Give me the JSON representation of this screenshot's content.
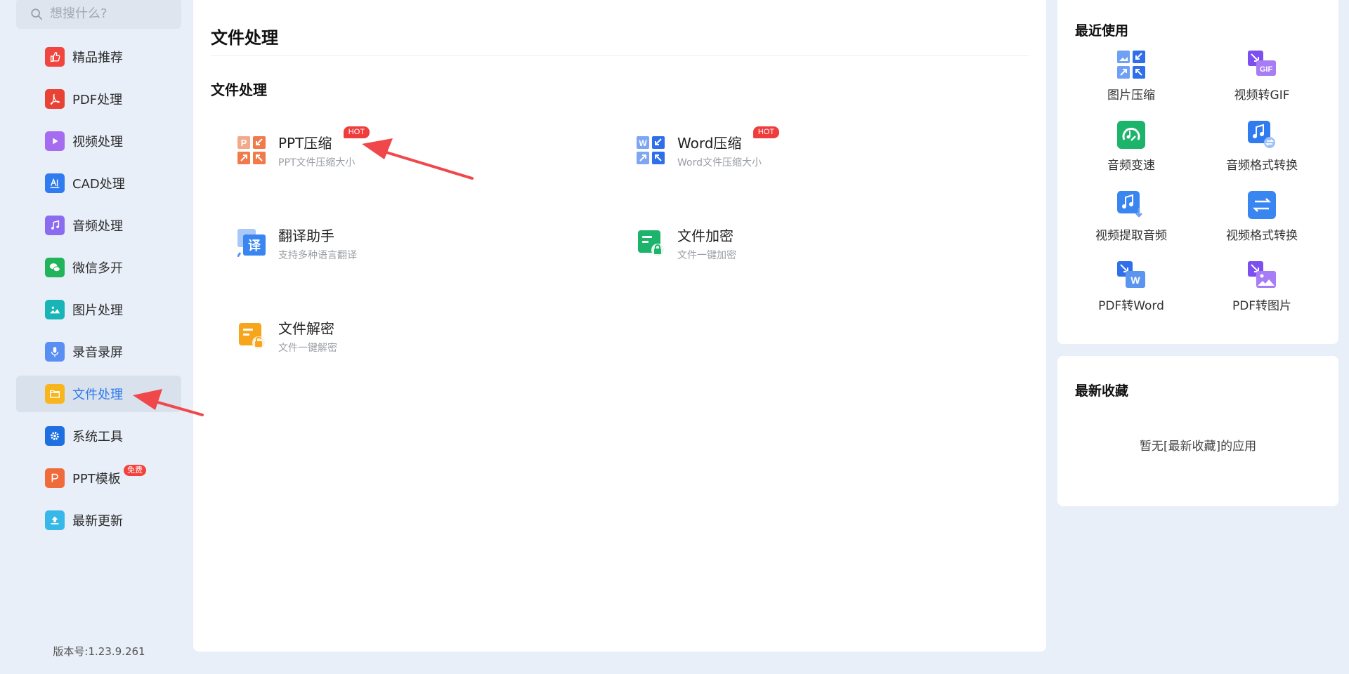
{
  "search": {
    "placeholder": "想搜什么?",
    "icon": "search-icon"
  },
  "sidebar": {
    "items": [
      {
        "label": "精品推荐",
        "icon": "thumbs-up-icon",
        "color": "#f0463f"
      },
      {
        "label": "PDF处理",
        "icon": "pdf-icon",
        "color": "#e94235"
      },
      {
        "label": "视频处理",
        "icon": "play-icon",
        "color": "#a66cf0"
      },
      {
        "label": "CAD处理",
        "icon": "cad-icon",
        "color": "#2f7bef"
      },
      {
        "label": "音频处理",
        "icon": "music-note-icon",
        "color": "#8b6cf0"
      },
      {
        "label": "微信多开",
        "icon": "wechat-icon",
        "color": "#22b45a"
      },
      {
        "label": "图片处理",
        "icon": "image-icon",
        "color": "#18b4b6"
      },
      {
        "label": "录音录屏",
        "icon": "microphone-icon",
        "color": "#5a8ef2"
      },
      {
        "label": "文件处理",
        "icon": "folder-icon",
        "color": "#f8b51c",
        "active": true
      },
      {
        "label": "系统工具",
        "icon": "gear-icon",
        "color": "#1e6fe0"
      },
      {
        "label": "PPT模板",
        "icon": "ppt-icon",
        "color": "#f06b3c",
        "badge": "免费"
      },
      {
        "label": "最新更新",
        "icon": "upload-icon",
        "color": "#37b8e8"
      }
    ]
  },
  "version": "版本号:1.23.9.261",
  "main": {
    "title": "文件处理",
    "section": "文件处理",
    "tools": [
      {
        "title": "PPT压缩",
        "desc": "PPT文件压缩大小",
        "badge": "HOT",
        "icon": "ppt-compress-icon"
      },
      {
        "title": "Word压缩",
        "desc": "Word文件压缩大小",
        "badge": "HOT",
        "icon": "word-compress-icon"
      },
      {
        "title": "翻译助手",
        "desc": "支持多种语言翻译",
        "icon": "translate-icon",
        "glyph": "译"
      },
      {
        "title": "文件加密",
        "desc": "文件一键加密",
        "icon": "file-encrypt-icon"
      },
      {
        "title": "文件解密",
        "desc": "文件一键解密",
        "icon": "file-decrypt-icon"
      }
    ]
  },
  "recent": {
    "title": "最近使用",
    "items": [
      {
        "label": "图片压缩",
        "icon": "image-compress-icon"
      },
      {
        "label": "视频转GIF",
        "icon": "video-to-gif-icon",
        "glyph": "GIF"
      },
      {
        "label": "音频变速",
        "icon": "audio-speed-icon"
      },
      {
        "label": "音频格式转换",
        "icon": "audio-convert-icon"
      },
      {
        "label": "视频提取音频",
        "icon": "video-extract-audio-icon"
      },
      {
        "label": "视频格式转换",
        "icon": "video-convert-icon"
      },
      {
        "label": "PDF转Word",
        "icon": "pdf-to-word-icon",
        "glyph": "W"
      },
      {
        "label": "PDF转图片",
        "icon": "pdf-to-image-icon"
      }
    ]
  },
  "favorites": {
    "title": "最新收藏",
    "empty": "暂无[最新收藏]的应用"
  },
  "colors": {
    "accent": "#2f7bef",
    "hot": "#ef3c3c",
    "annotation": "#f0484a"
  }
}
